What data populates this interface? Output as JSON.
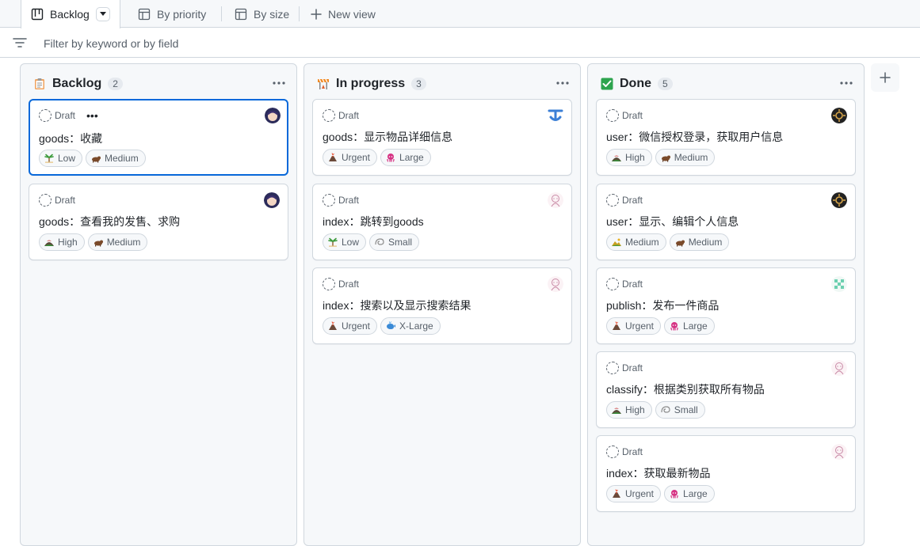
{
  "tabs": [
    {
      "label": "Backlog",
      "icon": "board-icon",
      "active": true
    },
    {
      "label": "By priority",
      "icon": "table-icon"
    },
    {
      "label": "By size",
      "icon": "table-icon"
    },
    {
      "label": "New view",
      "icon": "plus-icon"
    }
  ],
  "filter": {
    "placeholder": "Filter by keyword or by field"
  },
  "columns": [
    {
      "title": "Backlog",
      "count": "2",
      "icon": "clipboard-icon",
      "cards": [
        {
          "status": "Draft",
          "title": "goods：收藏",
          "avatar": "anime-avatar-dark",
          "labels": [
            {
              "text": "Low",
              "icon": "palm-tree-icon"
            },
            {
              "text": "Medium",
              "icon": "rabbit-icon"
            }
          ]
        },
        {
          "status": "Draft",
          "title": "goods：查看我的发售、求购",
          "avatar": "anime-avatar-dark",
          "labels": [
            {
              "text": "High",
              "icon": "mountain-icon"
            },
            {
              "text": "Medium",
              "icon": "rabbit-icon"
            }
          ]
        }
      ]
    },
    {
      "title": "In progress",
      "count": "3",
      "icon": "construction-icon",
      "cards": [
        {
          "status": "Draft",
          "title": "goods：显示物品详细信息",
          "avatar": "blue-logo-avatar",
          "labels": [
            {
              "text": "Urgent",
              "icon": "volcano-icon"
            },
            {
              "text": "Large",
              "icon": "octopus-icon"
            }
          ]
        },
        {
          "status": "Draft",
          "title": "index：跳转到goods",
          "avatar": "pink-sketch-avatar",
          "labels": [
            {
              "text": "Low",
              "icon": "palm-tree-icon"
            },
            {
              "text": "Small",
              "icon": "shell-icon"
            }
          ]
        },
        {
          "status": "Draft",
          "title": "index：搜索以及显示搜索结果",
          "avatar": "pink-sketch-avatar",
          "labels": [
            {
              "text": "Urgent",
              "icon": "volcano-icon"
            },
            {
              "text": "X-Large",
              "icon": "whale-icon"
            }
          ]
        }
      ]
    },
    {
      "title": "Done",
      "count": "5",
      "icon": "check-box-icon",
      "cards": [
        {
          "status": "Draft",
          "title": "user：微信授权登录，获取用户信息",
          "avatar": "dark-gear-avatar",
          "labels": [
            {
              "text": "High",
              "icon": "mountain-icon"
            },
            {
              "text": "Medium",
              "icon": "rabbit-icon"
            }
          ]
        },
        {
          "status": "Draft",
          "title": "user：显示、编辑个人信息",
          "avatar": "dark-gear-avatar",
          "labels": [
            {
              "text": "Medium",
              "icon": "hill-icon"
            },
            {
              "text": "Medium",
              "icon": "rabbit-icon"
            }
          ]
        },
        {
          "status": "Draft",
          "title": "publish：发布一件商品",
          "avatar": "green-pixel-avatar",
          "labels": [
            {
              "text": "Urgent",
              "icon": "volcano-icon"
            },
            {
              "text": "Large",
              "icon": "octopus-icon"
            }
          ]
        },
        {
          "status": "Draft",
          "title": "classify：根据类别获取所有物品",
          "avatar": "pink-sketch-avatar",
          "labels": [
            {
              "text": "High",
              "icon": "mountain-icon"
            },
            {
              "text": "Small",
              "icon": "shell-icon"
            }
          ]
        },
        {
          "status": "Draft",
          "title": "index：获取最新物品",
          "avatar": "pink-sketch-avatar",
          "labels": [
            {
              "text": "Urgent",
              "icon": "volcano-icon"
            },
            {
              "text": "Large",
              "icon": "octopus-icon"
            }
          ]
        }
      ]
    }
  ],
  "colors": {
    "accent": "#0969da",
    "done_check": "#2da44e"
  }
}
